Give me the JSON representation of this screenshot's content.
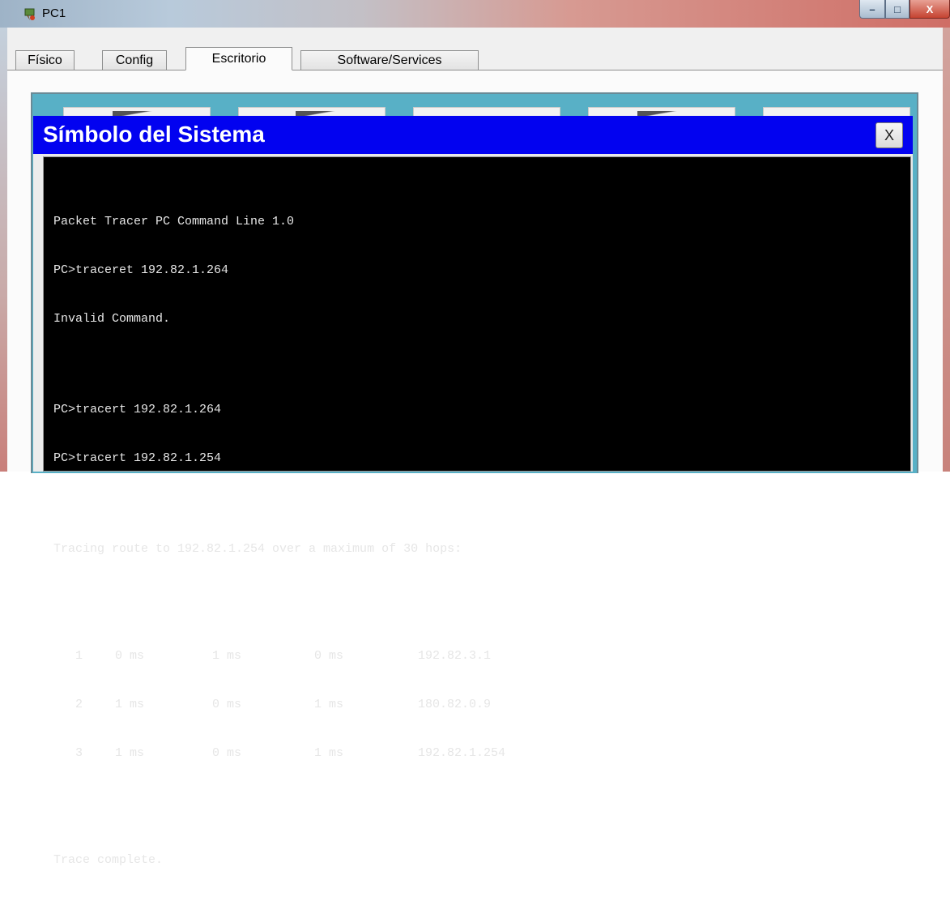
{
  "window": {
    "title": "PC1",
    "minimize_label": "–",
    "maximize_label": "□",
    "close_label": "X"
  },
  "tabs": [
    {
      "label": "Físico"
    },
    {
      "label": "Config"
    },
    {
      "label": "Escritorio",
      "active": true
    },
    {
      "label": "Software/Services"
    }
  ],
  "command_prompt": {
    "title": "Símbolo del Sistema",
    "close_label": "X",
    "lines_block1": [
      "Packet Tracer PC Command Line 1.0",
      "PC>traceret 192.82.1.264",
      "Invalid Command."
    ],
    "lines_block2": [
      "PC>tracert 192.82.1.264",
      "PC>tracert 192.82.1.254"
    ],
    "tracing_line": "Tracing route to 192.82.1.254 over a maximum of 30 hops:",
    "hops": [
      {
        "n": "1",
        "t1": "0 ms",
        "t2": "1 ms",
        "t3": "0 ms",
        "addr": "192.82.3.1"
      },
      {
        "n": "2",
        "t1": "1 ms",
        "t2": "0 ms",
        "t3": "1 ms",
        "addr": "180.82.0.9"
      },
      {
        "n": "3",
        "t1": "1 ms",
        "t2": "0 ms",
        "t3": "1 ms",
        "addr": "192.82.1.254"
      }
    ],
    "complete_line": "Trace complete."
  },
  "colors": {
    "cmd_header": "#0202f0",
    "desktop_bg": "#58b0c6",
    "terminal_bg": "#000000",
    "terminal_text": "#e6e6e6"
  },
  "icons": {
    "app_icon": "packet-tracer-pc-icon"
  }
}
